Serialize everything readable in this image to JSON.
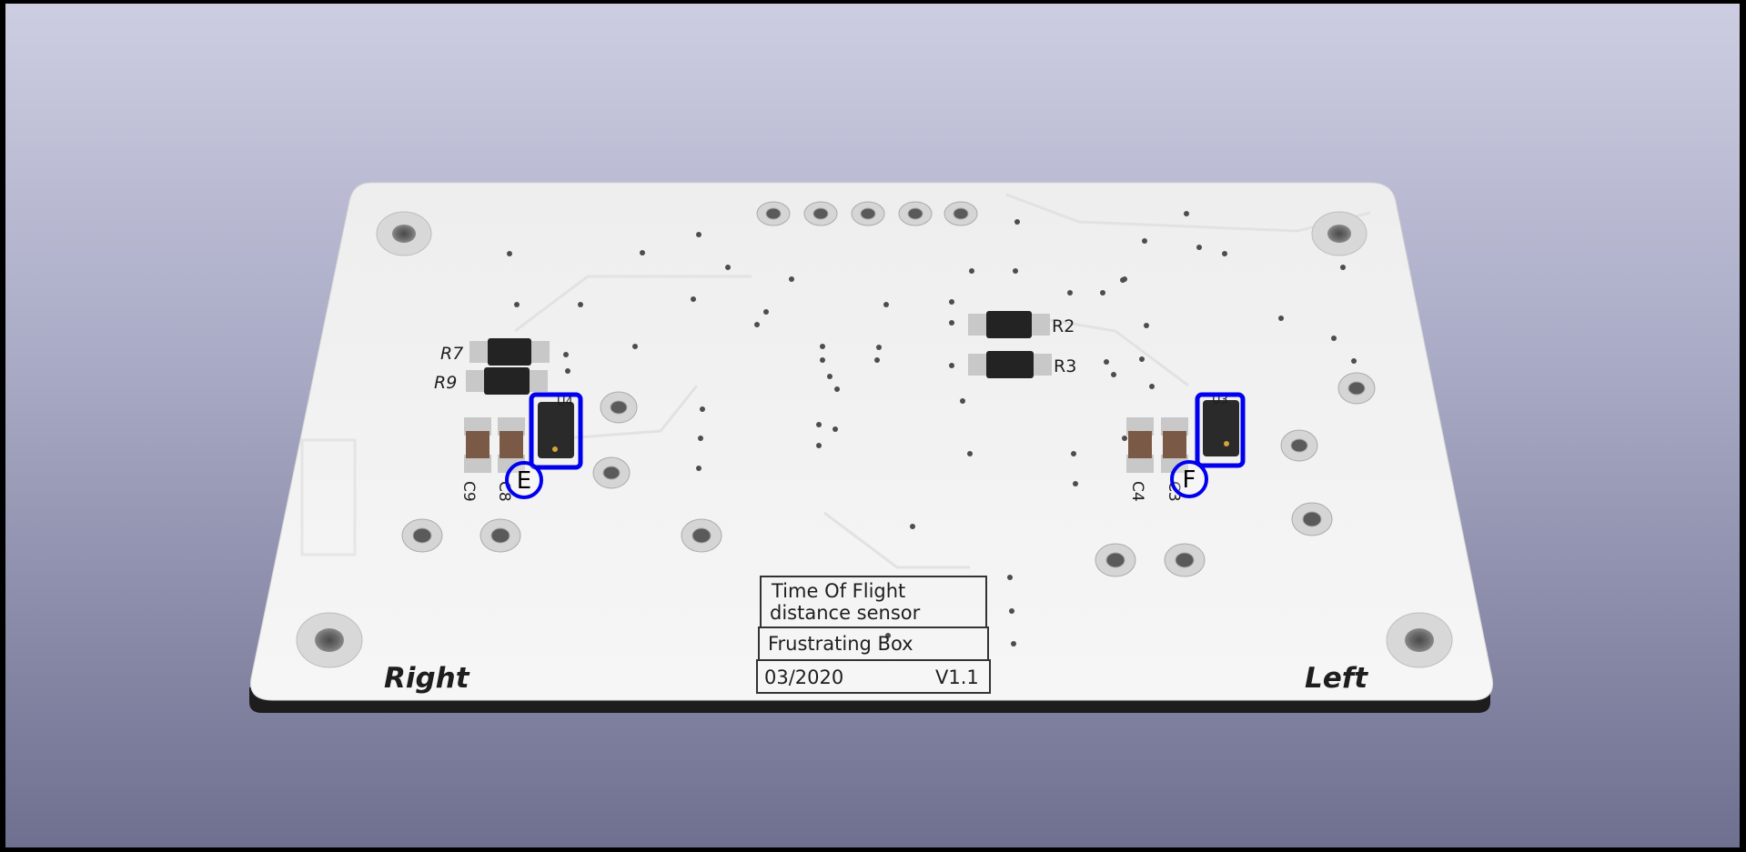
{
  "board": {
    "silkscreen": {
      "right": "Right",
      "left": "Left",
      "title_line1": "Time Of Flight",
      "title_line2": "distance sensor",
      "project": "Frustrating Box",
      "date": "03/2020",
      "version": "V1.1"
    },
    "refs": {
      "r7": "R7",
      "r9": "R9",
      "r2": "R2",
      "r3": "R3",
      "c9": "C9",
      "c8": "C8",
      "c4": "C4",
      "c3": "C3",
      "u4": "U4",
      "u3": "U3"
    },
    "markers": {
      "e": "E",
      "f": "F"
    }
  },
  "colors": {
    "board": "#f2f2f2",
    "marker": "#0000ee"
  }
}
